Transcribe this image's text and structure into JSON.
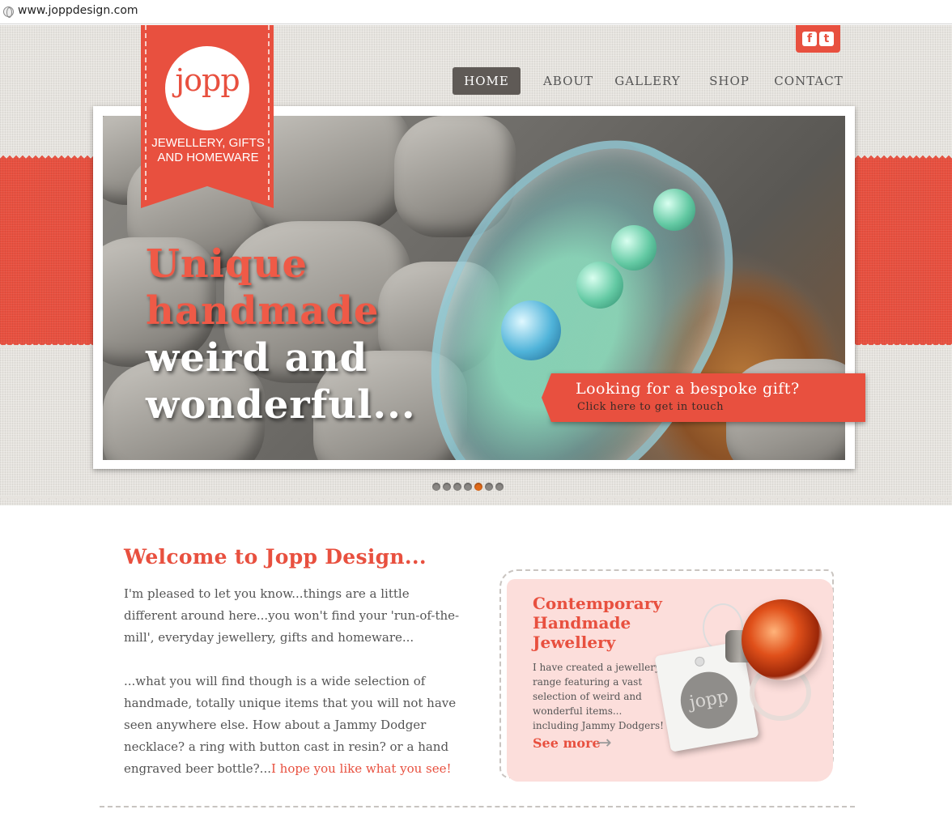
{
  "browser": {
    "url": "www.joppdesign.com"
  },
  "logo": {
    "word": "jopp",
    "tagline": "JEWELLERY, GIFTS AND HOMEWARE"
  },
  "social": {
    "facebook_glyph": "f",
    "twitter_glyph": "t"
  },
  "nav": {
    "items": [
      {
        "label": "HOME",
        "active": true
      },
      {
        "label": "ABOUT",
        "active": false
      },
      {
        "label": "GALLERY",
        "active": false
      },
      {
        "label": "SHOP",
        "active": false
      },
      {
        "label": "CONTACT",
        "active": false
      }
    ]
  },
  "hero": {
    "lines": [
      "Unique",
      "handmade",
      "weird and",
      "wonderful..."
    ],
    "cta_title": "Looking for a bespoke gift?",
    "cta_sub": "Click here to get in touch",
    "slide_count": 7,
    "active_slide": 5
  },
  "welcome": {
    "title": "Welcome to Jopp Design...",
    "para1": "I'm pleased to let you know...things are a little different around here...you won't find your 'run-of-the-mill', everyday jewellery, gifts and homeware...",
    "para2_main": "...what you will find though is a wide selection of handmade, totally unique items that you will not have seen anywhere else. How about a Jammy Dodger necklace? a ring with button cast in resin? or a hand engraved beer bottle?...",
    "para2_highlight": "I hope you like what you see!"
  },
  "promo": {
    "title": "Contemporary Handmade Jewellery",
    "text": "I have created a jewellery range featuring a vast selection of weird and wonderful items... including Jammy Dodgers!",
    "link": "See more",
    "tag_word": "jopp"
  },
  "colors": {
    "brand_red": "#e8503f",
    "nav_active_bg": "#5f5a56",
    "promo_bg": "#fcdedb"
  }
}
